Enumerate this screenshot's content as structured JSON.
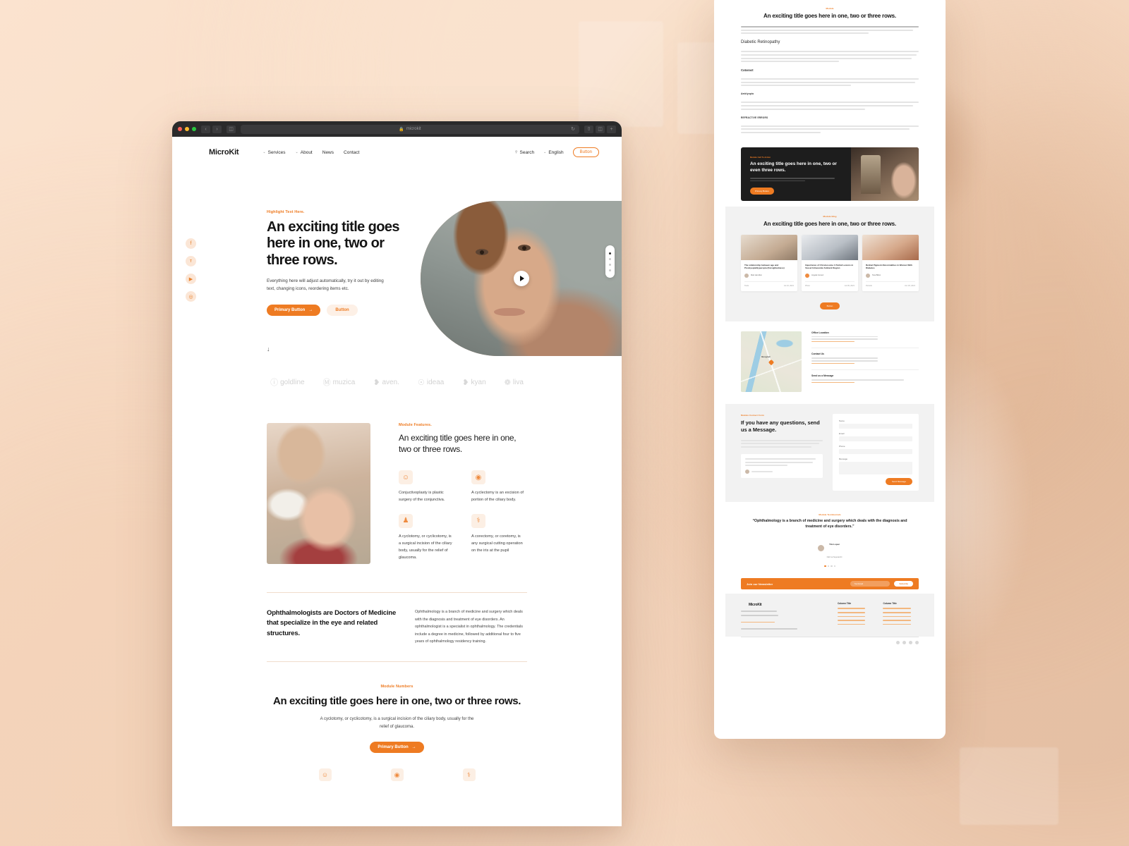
{
  "browser": {
    "url": "microkit",
    "lock_icon": "lock-icon",
    "reload_icon": "reload-icon"
  },
  "nav": {
    "brand": "MicroKit",
    "links": [
      {
        "label": "Services",
        "caret": "⌄"
      },
      {
        "label": "About",
        "caret": "⌄"
      },
      {
        "label": "News",
        "caret": ""
      },
      {
        "label": "Contact",
        "caret": ""
      }
    ],
    "search": "Search",
    "language": "English",
    "button": "Button"
  },
  "hero": {
    "eyebrow": "Highlight Text Here.",
    "title": "An exciting title goes here in one, two or three rows.",
    "body": "Everything here will adjust automatically, try it out by editing text, changing icons, reordering items etc.",
    "primary_button": "Primary Button",
    "secondary_button": "Button",
    "arrow": "→",
    "scroll_arrow": "↓",
    "play_icon": "play-icon"
  },
  "social": [
    {
      "name": "facebook-icon",
      "glyph": "f"
    },
    {
      "name": "twitter-icon",
      "glyph": "ᴛ"
    },
    {
      "name": "youtube-icon",
      "glyph": "▶"
    },
    {
      "name": "instagram-icon",
      "glyph": "◎"
    }
  ],
  "logos": [
    {
      "glyph": "ⓘ",
      "name": "goldline"
    },
    {
      "glyph": "Ⓜ",
      "name": "muzica"
    },
    {
      "glyph": "❥",
      "name": "aven."
    },
    {
      "glyph": "☉",
      "name": "ideaa"
    },
    {
      "glyph": "❥",
      "name": "kyan"
    },
    {
      "glyph": "❁",
      "name": "liva"
    }
  ],
  "features": {
    "eyebrow": "Module Features.",
    "title": "An exciting title goes here in one, two or three rows.",
    "items": [
      {
        "icon": "face-smile-icon",
        "glyph": "☺",
        "text": "Conjuctivoplasty is plastic surgery of the conjunctiva."
      },
      {
        "icon": "eye-icon",
        "glyph": "◉",
        "text": "A cyclectomy is an excision of portion of the ciliary body."
      },
      {
        "icon": "person-icon",
        "glyph": "♟",
        "text": "A cyclotomy, or cyclicotomy, is a surgical incision of the ciliary body, usually for the relief of glaucoma."
      },
      {
        "icon": "stethoscope-icon",
        "glyph": "⚕",
        "text": "A corectomy, or coretomy, is any surgical cutting operation on the iris at the pupil"
      }
    ]
  },
  "ophthalmologists": {
    "title": "Ophthalmologists are Doctors of Medicine that specialize in the eye and related structures.",
    "body": "Ophthalmology is a branch of medicine and surgery which deals with the diagnosis and treatment of eye disorders. An ophthalmologist is a specialist in ophthalmology. The credentials include a degree in medicine, followed by additional four to five years of ophthalmology residency training."
  },
  "numbers": {
    "eyebrow": "Module Numbers",
    "title": "An exciting title goes here in one, two or three rows.",
    "body": "A cyclotomy, or cyclicotomy, is a surgical incision of the ciliary body, usually for the relief of glaucoma.",
    "button": "Primary Button",
    "arrow": "→",
    "items": [
      {
        "icon": "face-smile-icon",
        "glyph": "☺"
      },
      {
        "icon": "eye-icon",
        "glyph": "◉"
      },
      {
        "icon": "stethoscope-icon",
        "glyph": "⚕"
      }
    ]
  },
  "board": {
    "article": {
      "eyebrow": "Module",
      "title": "An exciting title goes here in one, two or three rows.",
      "headings": [
        "Diabetic Retinopathy",
        "Cataract"
      ],
      "subheadings": [
        "Amblyopia",
        "REFRACTIVE ERRORS"
      ]
    },
    "cta": {
      "eyebrow": "Module Call To Action",
      "title": "An exciting title goes here in one, two or even three rows.",
      "button": "Primary Button"
    },
    "blog": {
      "eyebrow": "Module Blog",
      "title": "An exciting title goes here in one, two or three rows.",
      "cards": [
        {
          "title": "The relationship between age and Presbyopia/Hyperopia (Farsightedness)",
          "author": "Matt Hamilton",
          "category": "Tools",
          "date": "Jul 24, 2021"
        },
        {
          "title": "Importance of Chromosome 1 Partial Lesions in Vessel Intraocular Ambient Region",
          "author": "Angela Gomez",
          "category": "Photo",
          "date": "Jul 09, 2021"
        },
        {
          "title": "Retinal Pigment Abnormalities in Women With Diabetes",
          "author": "Tara Bilton",
          "category": "Periods",
          "date": "Jun 18, 2021"
        }
      ],
      "button": "Button"
    },
    "map": {
      "city": "Beograd",
      "blocks": [
        {
          "title": "Office Location"
        },
        {
          "title": "Contact Us"
        },
        {
          "title": "Send us a Message"
        }
      ]
    },
    "form": {
      "eyebrow": "Module Contact Form",
      "title": "If you have any questions, send us a Message.",
      "fields": [
        "Name",
        "Email",
        "Phone",
        "Message"
      ],
      "submit": "Send Message"
    },
    "testimonial": {
      "eyebrow": "Module Testimonials",
      "quote": "“Ophthalmology is a branch of medicine and surgery which deals with the diagnosis and treatment of eye disorders.”",
      "author": "Tim Lopez",
      "role": "CEO at Superarchi"
    },
    "newsletter": {
      "title": "Join our Newsletter",
      "placeholder": "Your Email",
      "button": "Subscribe"
    },
    "footer": {
      "brand": "MicroKit",
      "columns": [
        "Column Title",
        "Column Title"
      ]
    }
  },
  "colors": {
    "accent": "#ee7b22",
    "accent_light": "#fcefe4",
    "ink": "#141414",
    "page_bg": "#f2f2f2"
  }
}
